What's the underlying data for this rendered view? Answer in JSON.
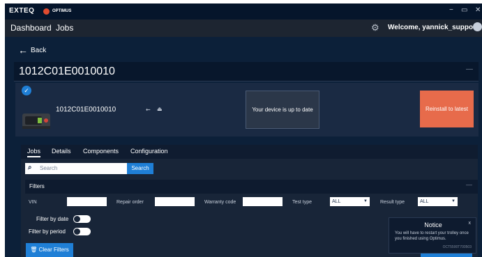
{
  "titlebar": {
    "brand": "EXTEQ",
    "product": "OPTIMUS",
    "minimize": "−",
    "maximize": "▭",
    "close": "✕"
  },
  "nav": {
    "dashboard": "Dashboard",
    "jobs": "Jobs",
    "welcome": "Welcome, yannick_support"
  },
  "back_label": "Back",
  "device": {
    "serial_title": "1012C01E0010010",
    "serial": "1012C01E0010010",
    "status": "Your device is up to date",
    "reinstall_label": "Reinstall to latest"
  },
  "tabs": [
    "Jobs",
    "Details",
    "Components",
    "Configuration"
  ],
  "search": {
    "placeholder": "Search",
    "button": "Search"
  },
  "filters": {
    "title": "Filters",
    "vin_label": "VIN",
    "repair_order_label": "Repair order",
    "warranty_code_label": "Warranty code",
    "test_type_label": "Test type",
    "test_type_value": "ALL",
    "result_type_label": "Result type",
    "result_type_value": "ALL",
    "filter_by_date": "Filter by date",
    "filter_by_period": "Filter by period",
    "clear_button": "Clear Filters"
  },
  "notice": {
    "title": "Notice",
    "close": "x",
    "message": "You will have to restart your trolley once you finished using Optimus.",
    "code": "OCT5500T700503"
  },
  "colors": {
    "background": "#0c2039",
    "accent": "#1f7fd6",
    "reinstall": "#e76b4b"
  }
}
